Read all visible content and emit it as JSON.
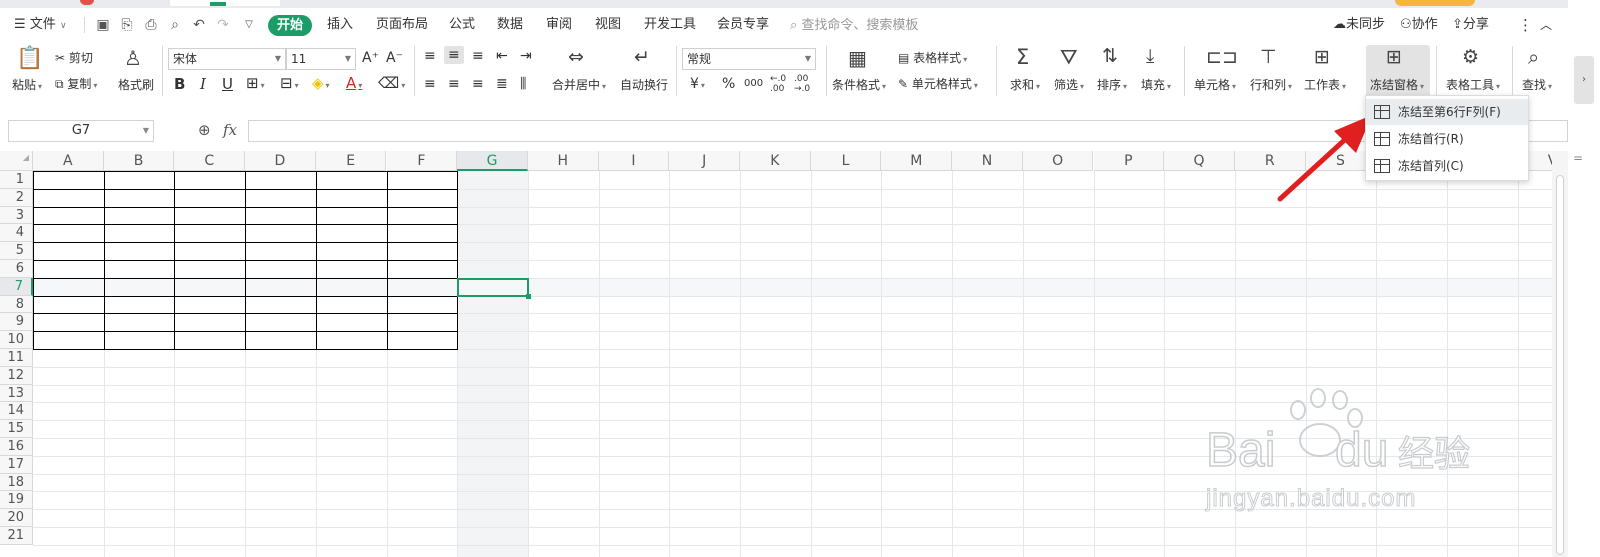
{
  "menu": {
    "file_label": "文件",
    "start_tab": "开始",
    "tabs": [
      "插入",
      "页面布局",
      "公式",
      "数据",
      "审阅",
      "视图",
      "开发工具",
      "会员专享"
    ],
    "search_placeholder": "查找命令、搜索模板",
    "unsync_label": "未同步",
    "collab_label": "协作",
    "share_label": "分享"
  },
  "ribbon": {
    "paste": "粘贴",
    "cut": "剪切",
    "copy": "复制",
    "format_painter": "格式刷",
    "font_name": "宋体",
    "font_size": "11",
    "bold": "B",
    "italic": "I",
    "underline": "U",
    "merge_center": "合并居中",
    "wrap_text": "自动换行",
    "number_format": "常规",
    "currency": "¥",
    "percent": "%",
    "thousands": "000",
    "inc_decimal": "←.0 .00",
    "dec_decimal": ".00 →.0",
    "cond_format": "条件格式",
    "table_style": "表格样式",
    "cell_style": "单元格样式",
    "sum": "求和",
    "filter": "筛选",
    "sort": "排序",
    "fill": "填充",
    "cell": "单元格",
    "row_col": "行和列",
    "worksheet": "工作表",
    "freeze_panes": "冻结窗格",
    "table_tools": "表格工具",
    "find": "查找"
  },
  "formula_bar": {
    "name_box": "G7",
    "fx": "fx",
    "zoom_icon": "magnifier-icon"
  },
  "sheet": {
    "columns": [
      "A",
      "B",
      "C",
      "D",
      "E",
      "F",
      "G",
      "H",
      "I",
      "J",
      "K",
      "L",
      "M",
      "N",
      "O",
      "P",
      "Q",
      "R",
      "S",
      "T",
      "U",
      "V"
    ],
    "rows": [
      "1",
      "2",
      "3",
      "4",
      "5",
      "6",
      "7",
      "8",
      "9",
      "10",
      "11",
      "12",
      "13",
      "14",
      "15",
      "16",
      "17",
      "18",
      "19",
      "20",
      "21"
    ],
    "selected_cell": "G7",
    "accent": "#1c9d68"
  },
  "freeze_menu": {
    "items": [
      "冻结至第6行F列(F)",
      "冻结首行(R)",
      "冻结首列(C)"
    ]
  },
  "watermark": {
    "brand_prefix": "Bai",
    "brand_suffix": "du",
    "brand_cn": "经验",
    "url": "jingyan.baidu.com"
  },
  "colors": {
    "brand_green": "#1c9d68",
    "arrow_red": "#e02020",
    "gridline": "#e4e8ec"
  }
}
